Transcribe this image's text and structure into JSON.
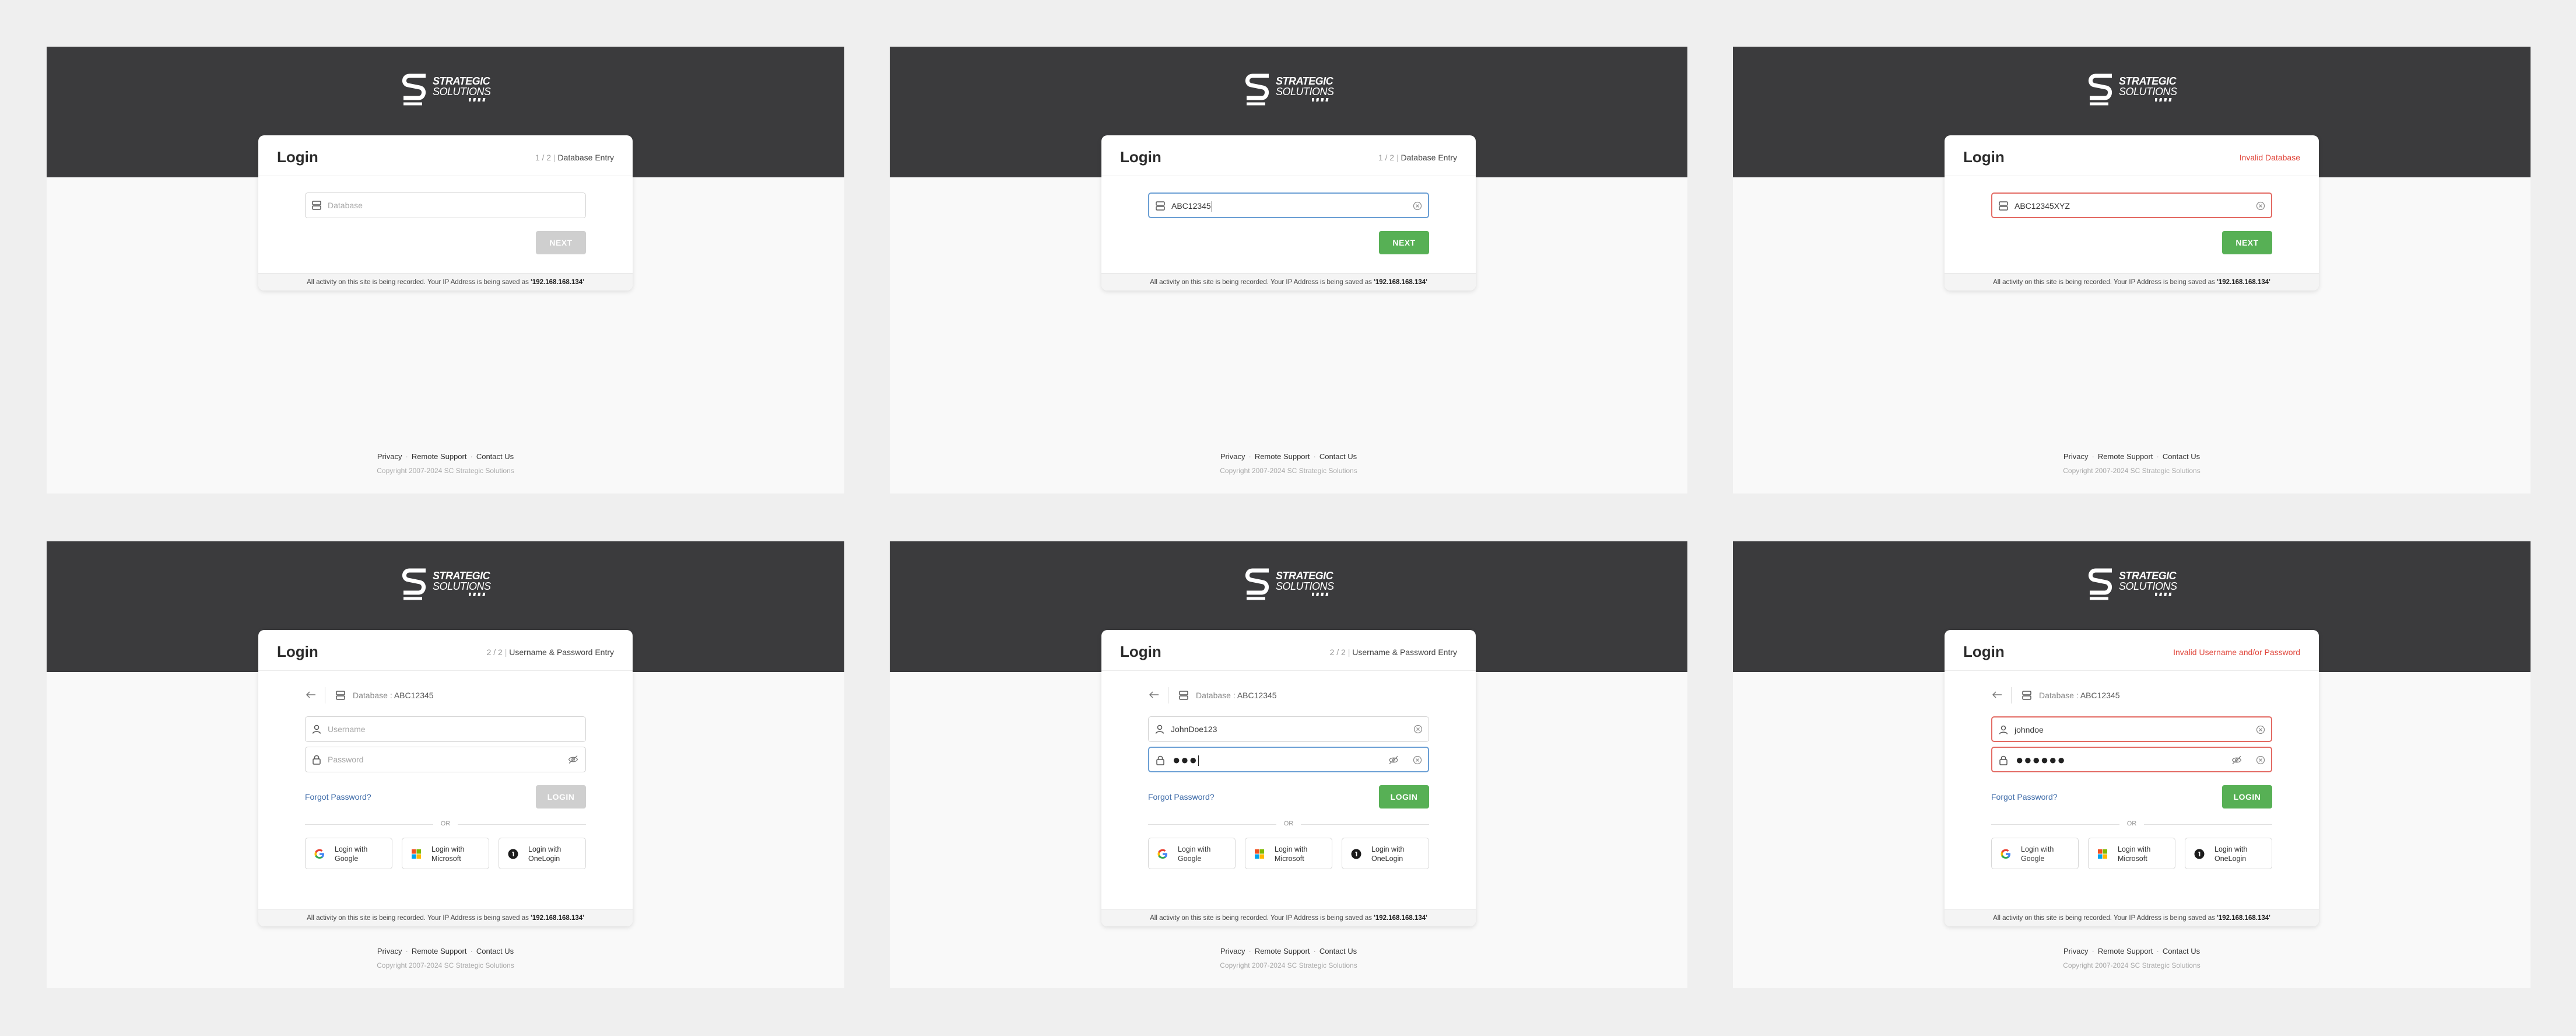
{
  "brand": {
    "line1": "STRATEGIC",
    "line2": "SOLUTIONS"
  },
  "card_title": "Login",
  "activity_notice": {
    "text": "All activity on this site is being recorded. Your IP Address is being saved as ",
    "ip": "'192.168.168.134'"
  },
  "footer": {
    "privacy": "Privacy",
    "remote_support": "Remote Support",
    "contact_us": "Contact Us",
    "separator": "·",
    "copyright": "Copyright 2007-2024 SC Strategic Solutions"
  },
  "step1": {
    "num": "1 / 2",
    "sep": "|",
    "label": "Database Entry"
  },
  "step2": {
    "num": "2 / 2",
    "sep": "|",
    "label": "Username & Password Entry"
  },
  "errors": {
    "database": "Invalid Database",
    "credentials": "Invalid Username and/or Password"
  },
  "placeholders": {
    "database": "Database",
    "username": "Username",
    "password": "Password"
  },
  "buttons": {
    "next": "NEXT",
    "login": "LOGIN"
  },
  "values": {
    "db_typed": "ABC12345",
    "db_invalid": "ABC12345XYZ",
    "username_typed": "JohnDoe123",
    "username_invalid": "johndoe",
    "password_short": "●●●",
    "password_long": "●●●●●●"
  },
  "database_row": {
    "key": "Database",
    "sep": ":",
    "value": "ABC12345"
  },
  "forgot_password": "Forgot Password?",
  "or": "OR",
  "sso": {
    "google": {
      "line1": "Login with",
      "line2": "Google"
    },
    "microsoft": {
      "line1": "Login with",
      "line2": "Microsoft"
    },
    "onelogin": {
      "line1": "Login with",
      "line2": "OneLogin"
    }
  },
  "colors": {
    "header_bg": "#3b3b3d",
    "primary_green": "#57b055",
    "error_red": "#e0473c",
    "focus_blue": "#6b9fd4",
    "link_blue": "#3c6aa8",
    "disabled_gray": "#cfcfcf"
  },
  "icons": [
    "database-icon",
    "user-icon",
    "lock-icon",
    "clear-icon",
    "eye-off-icon",
    "back-arrow-icon",
    "google-icon",
    "microsoft-icon",
    "onelogin-icon"
  ]
}
